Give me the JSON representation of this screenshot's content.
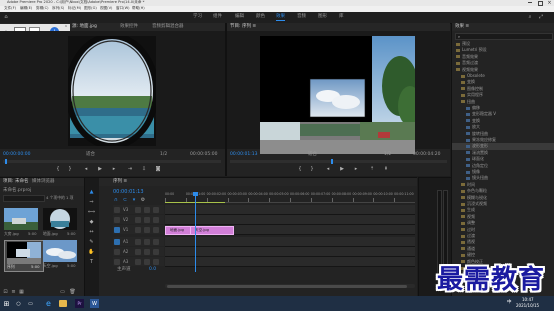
{
  "title_bar": {
    "title": "Adobe Premiere Pro 2020 - C:\\用户\\Nbox\\文档\\Adobe\\Premiere Pro\\14.0\\未命 *"
  },
  "menu_bar": {
    "items": [
      "文件(F)",
      "编辑(E)",
      "剪辑(C)",
      "序列(S)",
      "标记(M)",
      "图形(G)",
      "视图(V)",
      "窗口(W)",
      "帮助(H)"
    ]
  },
  "workspace_tabs": {
    "items": [
      "学习",
      "组件",
      "编辑",
      "颜色",
      "效果",
      "音频",
      "图形",
      "库"
    ],
    "active_index": 4
  },
  "source_monitor": {
    "tabs": [
      "源: 地面.jpg",
      "效果控件",
      "音频剪辑混合器"
    ],
    "timecode_left": "00:00:00:00",
    "fit": "适合",
    "ratio": "1/2",
    "timecode_right": "00:00:05:00"
  },
  "program_monitor": {
    "tab": "节目: 序列 ≡",
    "timecode_left": "00:00:01:13",
    "fit": "适合",
    "ratio": "1/2",
    "timecode_right": "00:00:04:20"
  },
  "effects_panel": {
    "title": "效果 ≡",
    "tree": [
      {
        "label": "预设",
        "level": 0
      },
      {
        "label": "Lumetri 预设",
        "level": 0
      },
      {
        "label": "音频效果",
        "level": 0
      },
      {
        "label": "音频过渡",
        "level": 0
      },
      {
        "label": "视频效果",
        "level": 0
      },
      {
        "label": "Obsolete",
        "level": 1
      },
      {
        "label": "变换",
        "level": 1
      },
      {
        "label": "图像控制",
        "level": 1
      },
      {
        "label": "实用程序",
        "level": 1
      },
      {
        "label": "扭曲",
        "level": 1
      },
      {
        "label": "偏移",
        "level": 2
      },
      {
        "label": "变形稳定器 V",
        "level": 2
      },
      {
        "label": "变换",
        "level": 2
      },
      {
        "label": "放大",
        "level": 2
      },
      {
        "label": "旋转扭曲",
        "level": 2
      },
      {
        "label": "果冻效应修复",
        "level": 2
      },
      {
        "label": "波形变形",
        "level": 2
      },
      {
        "label": "湍流置换",
        "level": 2
      },
      {
        "label": "球面化",
        "level": 2
      },
      {
        "label": "边角定位",
        "level": 2
      },
      {
        "label": "镜像",
        "level": 2
      },
      {
        "label": "镜头扭曲",
        "level": 2
      },
      {
        "label": "时间",
        "level": 1
      },
      {
        "label": "杂色与颗粒",
        "level": 1
      },
      {
        "label": "模糊与锐化",
        "level": 1
      },
      {
        "label": "沉浸式视频",
        "level": 1
      },
      {
        "label": "生成",
        "level": 1
      },
      {
        "label": "视频",
        "level": 1
      },
      {
        "label": "调整",
        "level": 1
      },
      {
        "label": "过时",
        "level": 1
      },
      {
        "label": "过渡",
        "level": 1
      },
      {
        "label": "透视",
        "level": 1
      },
      {
        "label": "通道",
        "level": 1
      },
      {
        "label": "键控",
        "level": 1
      },
      {
        "label": "颜色校正",
        "level": 1
      },
      {
        "label": "风格化",
        "level": 1
      },
      {
        "label": "视频过渡",
        "level": 0
      }
    ],
    "selected_index": 16
  },
  "project_panel": {
    "tabs": [
      "项目: 未命名",
      "媒体浏览器"
    ],
    "path": "未命名.prproj",
    "count": "4 个项中的 1 项",
    "items": [
      {
        "name": "大房.jpg",
        "duration": "5:00"
      },
      {
        "name": "地面.jpg",
        "duration": "5:00"
      },
      {
        "name": "序列",
        "duration": "5:00"
      },
      {
        "name": "天空.jpg",
        "duration": "5:00"
      }
    ]
  },
  "timeline": {
    "tab": "序列 ≡",
    "timecode": "00:00:01:13",
    "ruler": [
      "00:00",
      "00:00:01:00",
      "00:00:02:00",
      "00:00:03:00",
      "00:00:04:00",
      "00:00:05:00",
      "00:00:06:00",
      "00:00:07:00",
      "00:00:08:00",
      "00:00:09:00",
      "00:00:10:00",
      "00:00:11:00"
    ],
    "tracks": [
      {
        "name": "V3"
      },
      {
        "name": "V2"
      },
      {
        "name": "V1"
      },
      {
        "name": "A1"
      },
      {
        "name": "A2"
      },
      {
        "name": "A3"
      }
    ],
    "master_label": "主声道",
    "master_value": "0.0",
    "clips": [
      {
        "track": "V1",
        "label": "地面.jpg"
      },
      {
        "track": "V1",
        "label": "天空.jpg"
      }
    ]
  },
  "taskbar": {
    "time": "10:47",
    "date": "2021/10/15",
    "lang": "中"
  },
  "watermark": "最需教育",
  "colors": {
    "accent": "#2d8ceb",
    "clip": "#d27fd8",
    "watermark": "#1a1aa0"
  }
}
